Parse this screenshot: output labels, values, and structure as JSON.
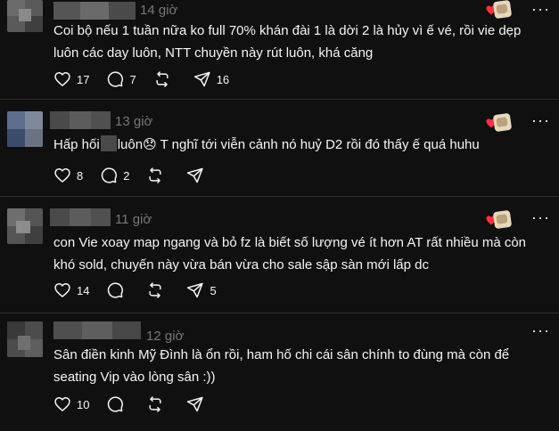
{
  "posts": [
    {
      "time": "14 giờ",
      "lines": [
        "Coi bộ nếu 1 tuần nữa ko full 70% khán đài 1 là dời 2 là hủy vì ế vé, rồi vie dẹp",
        "luôn các day luôn, NTT chuyền này rút luôn, khá căng"
      ],
      "likes": "17",
      "comments": "7",
      "reposts": "",
      "shares": "16"
    },
    {
      "time": "13 giờ",
      "text_before": "Hấp hối",
      "text_after": "luôn😞 T nghĩ tới viễn cảnh nó huỷ D2 rồi đó thấy ế quá huhu",
      "likes": "8",
      "comments": "2",
      "reposts": "",
      "shares": ""
    },
    {
      "time": "11 giờ",
      "lines": [
        "con Vie xoay map ngang và bỏ fz là biết số lượng vé ít hơn AT rất nhiều mà còn",
        "khó sold, chuyến này vừa bán vừa cho sale sập sàn mới lấp dc"
      ],
      "likes": "14",
      "comments": "",
      "reposts": "",
      "shares": "5"
    },
    {
      "time": "12 giờ",
      "lines": [
        "Sân điền kinh Mỹ Đình là ổn rồi, ham hố chi cái sân chính to đùng mà còn để",
        "seating Vip vào lòng sân :))"
      ],
      "likes": "10",
      "comments": "",
      "reposts": "",
      "shares": ""
    }
  ],
  "icons": {
    "like": "heart-outline-icon",
    "comment": "speech-bubble-icon",
    "repost": "repost-arrows-icon",
    "share": "paper-plane-icon",
    "more": "more-options-icon"
  },
  "colors": {
    "background": "#101010",
    "text": "#f3f5f7",
    "muted": "#777777",
    "divider": "#2d2d2d",
    "reaction_heart": "#ff3040"
  },
  "more_glyph": "···"
}
